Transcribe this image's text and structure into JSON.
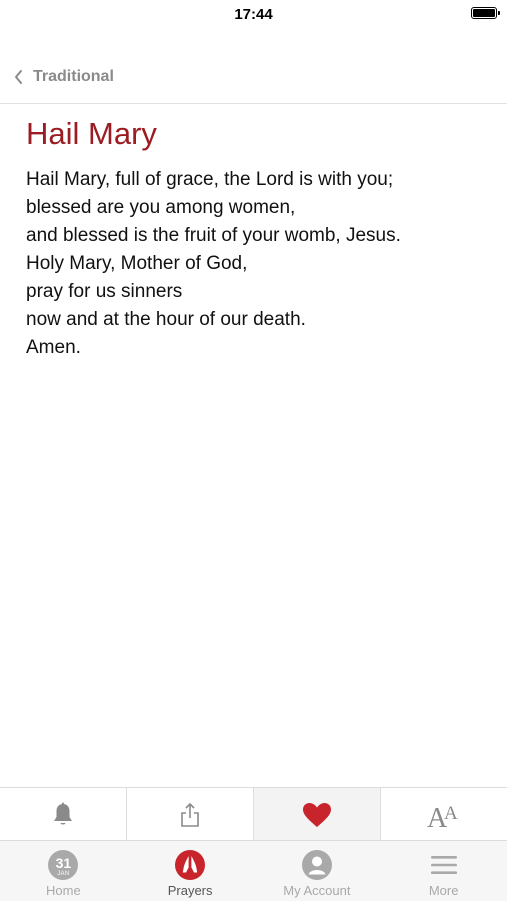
{
  "status": {
    "time": "17:44"
  },
  "nav": {
    "back_label": "Traditional"
  },
  "prayer": {
    "title": "Hail Mary",
    "lines": [
      "Hail Mary, full of grace, the Lord is with you;",
      "blessed are you among women,",
      "and blessed is the fruit of your womb, Jesus.",
      "Holy Mary, Mother of God,",
      "pray for us sinners",
      "now and at the hour of our death.",
      "Amen."
    ]
  },
  "actions": [
    {
      "icon": "bell-icon"
    },
    {
      "icon": "share-icon"
    },
    {
      "icon": "heart-icon",
      "active": true,
      "color": "#c8242b"
    },
    {
      "icon": "text-size-icon"
    }
  ],
  "tabs": {
    "home": {
      "label": "Home",
      "day": "31",
      "month": "JAN"
    },
    "prayers": {
      "label": "Prayers",
      "active": true
    },
    "account": {
      "label": "My Account"
    },
    "more": {
      "label": "More"
    }
  },
  "colors": {
    "accent": "#9b1d24",
    "heart": "#c8242b",
    "icon_gray": "#8a8a8a",
    "tab_inactive": "#a9a9a9"
  }
}
